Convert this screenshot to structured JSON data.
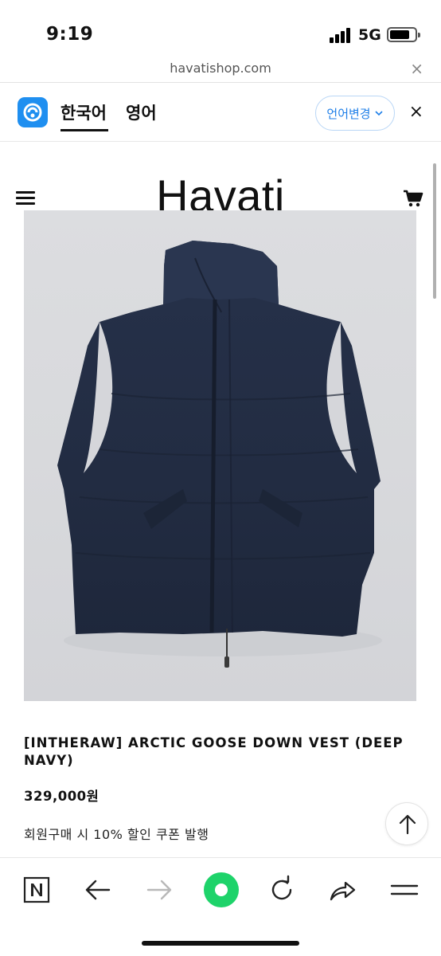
{
  "status_bar": {
    "time": "9:19",
    "network": "5G"
  },
  "browser": {
    "url": "havatishop.com",
    "close_symbol": "×"
  },
  "translate_bar": {
    "source_lang": "한국어",
    "target_lang": "영어",
    "change_label": "언어변경",
    "chevron": "⌄",
    "close_symbol": "×"
  },
  "site": {
    "brand": "Havati"
  },
  "product": {
    "title": "[INTHERAW] ARCTIC GOOSE DOWN VEST (DEEP NAVY)",
    "price": "329,000원",
    "coupon_note": "회원구매 시 10% 할인 쿠폰 발행"
  },
  "icons": {
    "menu": "hamburger-menu-icon",
    "cart": "shopping-cart-icon",
    "scroll_top": "arrow-up-icon",
    "nav": [
      "naver-n-icon",
      "back-arrow-icon",
      "forward-arrow-icon",
      "green-dot-home-icon",
      "refresh-icon",
      "share-icon",
      "more-menu-icon"
    ]
  },
  "colors": {
    "accent_blue": "#1f7fe8",
    "logo_blue": "#1f8ff0",
    "green_button": "#1ed36a",
    "vest_navy": "#232e42"
  }
}
